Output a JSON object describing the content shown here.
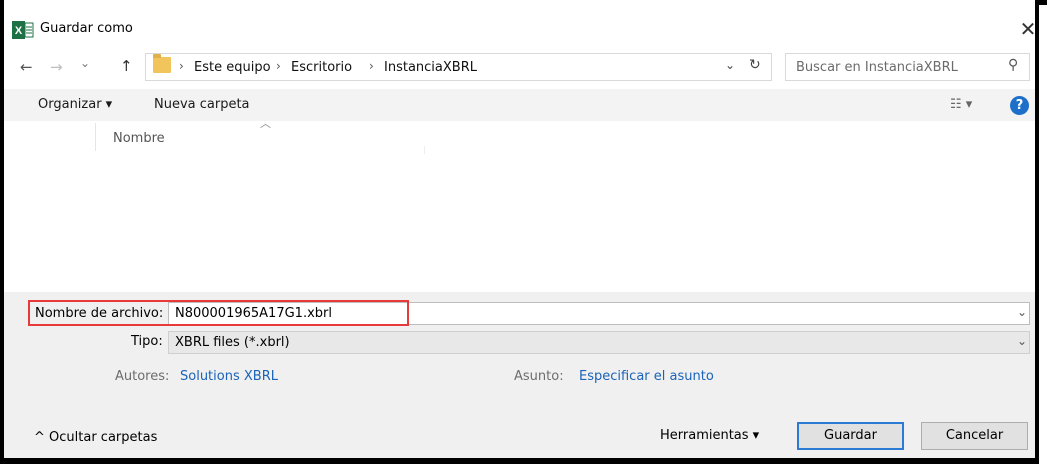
{
  "window": {
    "title": "Guardar como",
    "close_glyph": "✕",
    "app_icon": "excel-icon"
  },
  "nav": {
    "back": "←",
    "forward": "→",
    "recent": "⌄",
    "up": "↑",
    "breadcrumb": [
      "Este equipo",
      "Escritorio",
      "InstanciaXBRL"
    ],
    "separator": "›",
    "dropdown": "⌄",
    "refresh": "↻"
  },
  "search": {
    "placeholder": "Buscar en InstanciaXBRL",
    "icon": "⚲"
  },
  "toolbar": {
    "organize": "Organizar ▾",
    "new_folder": "Nueva carpeta",
    "view": "☷ ▾",
    "help": "?"
  },
  "file_list": {
    "column_name": "Nombre",
    "sort_caret": "︿"
  },
  "form": {
    "filename_label": "Nombre de archivo:",
    "filename_value": "N800001965A17G1.xbrl",
    "type_label": "Tipo:",
    "type_value": "XBRL files (*.xbrl)",
    "authors_label": "Autores:",
    "authors_value": "Solutions XBRL",
    "subject_label": "Asunto:",
    "subject_value": "Especificar el asunto",
    "chevron": "⌄"
  },
  "footer": {
    "hide_folders": "^  Ocultar carpetas",
    "tools": "Herramientas   ▾",
    "save": "Guardar",
    "cancel": "Cancelar"
  },
  "colors": {
    "highlight": "#e8393b",
    "accent": "#2b7ad3",
    "link": "#1a63b8",
    "help": "#1d6fc9"
  }
}
